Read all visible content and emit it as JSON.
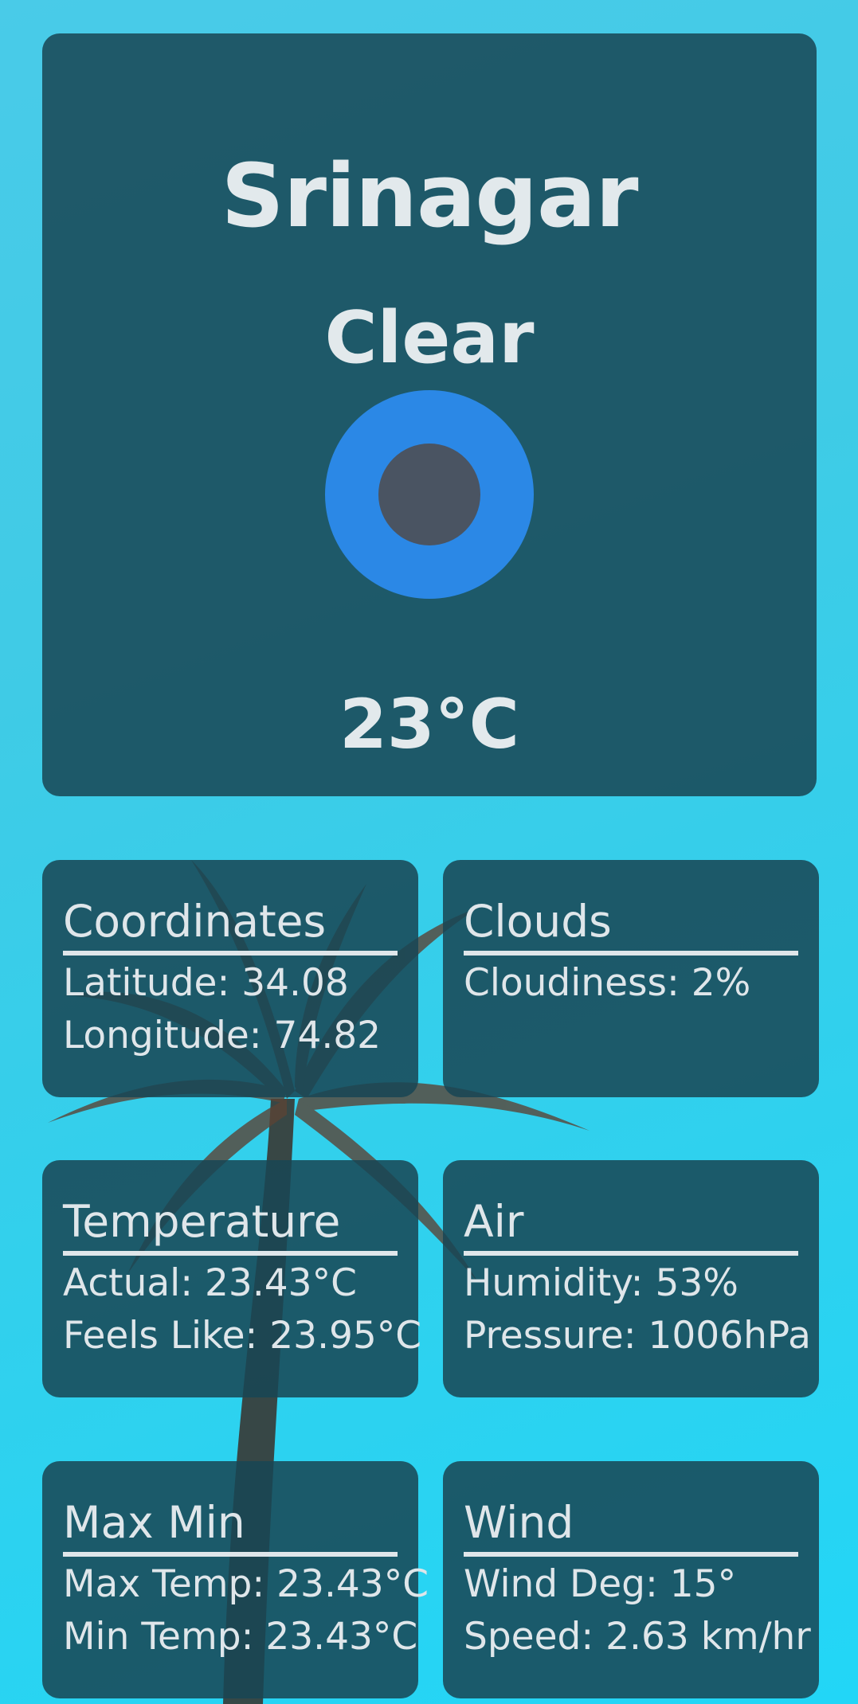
{
  "main": {
    "city": "Srinagar",
    "condition": "Clear",
    "icon": "weather-clear-icon",
    "temperature": "23°C"
  },
  "cards": {
    "coordinates": {
      "title": "Coordinates",
      "line1": "Latitude: 34.08",
      "line2": "Longitude: 74.82"
    },
    "clouds": {
      "title": "Clouds",
      "line1": "Cloudiness: 2%"
    },
    "temperature": {
      "title": "Temperature",
      "line1": "Actual: 23.43°C",
      "line2": "Feels Like: 23.95°C"
    },
    "air": {
      "title": "Air",
      "line1": "Humidity: 53%",
      "line2": "Pressure: 1006hPa"
    },
    "maxmin": {
      "title": "Max Min",
      "line1": "Max Temp: 23.43°C",
      "line2": "Min Temp: 23.43°C"
    },
    "wind": {
      "title": "Wind",
      "line1": "Wind Deg: 15°",
      "line2": "Speed: 2.63 km/hr"
    }
  },
  "colors": {
    "background": "#3fcbe6",
    "card": "#184654",
    "icon_outer": "#2b88e6",
    "icon_inner": "#4a5462",
    "text": "#e2e9ec"
  }
}
